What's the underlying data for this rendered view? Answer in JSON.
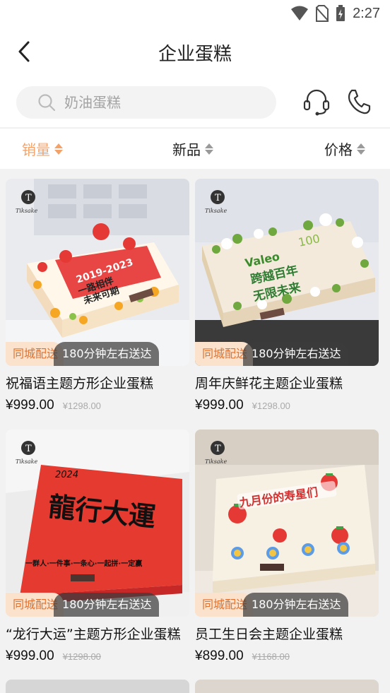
{
  "status": {
    "time": "2:27"
  },
  "header": {
    "title": "企业蛋糕"
  },
  "search": {
    "placeholder": "奶油蛋糕"
  },
  "sort": {
    "sales": "销量",
    "new": "新品",
    "price": "价格"
  },
  "colors": {
    "accent": "#f3a36a",
    "badge_text": "#e2712d"
  },
  "products": [
    {
      "name": "祝福语主题方形企业蛋糕",
      "price": "¥999.00",
      "original_price": "¥1298.00",
      "badge_local": "同城配送",
      "badge_time": "180分钟左右送达",
      "cake_text": [
        "2019-2023",
        "一路相伴",
        "未来可期"
      ],
      "brand": "Tiksake"
    },
    {
      "name": "周年庆鲜花主题企业蛋糕",
      "price": "¥999.00",
      "original_price": "¥1298.00",
      "badge_local": "同城配送",
      "badge_time": "180分钟左右送达",
      "cake_text": [
        "Valeo",
        "100",
        "跨越百年",
        "无限未来"
      ],
      "brand": "Tiksake"
    },
    {
      "name": "“龙行大运”主题方形企业蛋糕",
      "price": "¥999.00",
      "original_price": "¥1298.00",
      "badge_local": "同城配送",
      "badge_time": "180分钟左右送达",
      "cake_text": [
        "2024",
        "龍行大運",
        "一群人·一件事·一条心·一起拼·一定赢"
      ],
      "brand": "Tiksake"
    },
    {
      "name": "员工生日会主题企业蛋糕",
      "price": "¥899.00",
      "original_price": "¥1168.00",
      "badge_local": "同城配送",
      "badge_time": "180分钟左右送达",
      "cake_text": [
        "九月份的寿星们"
      ],
      "brand": "Tiksake"
    }
  ]
}
